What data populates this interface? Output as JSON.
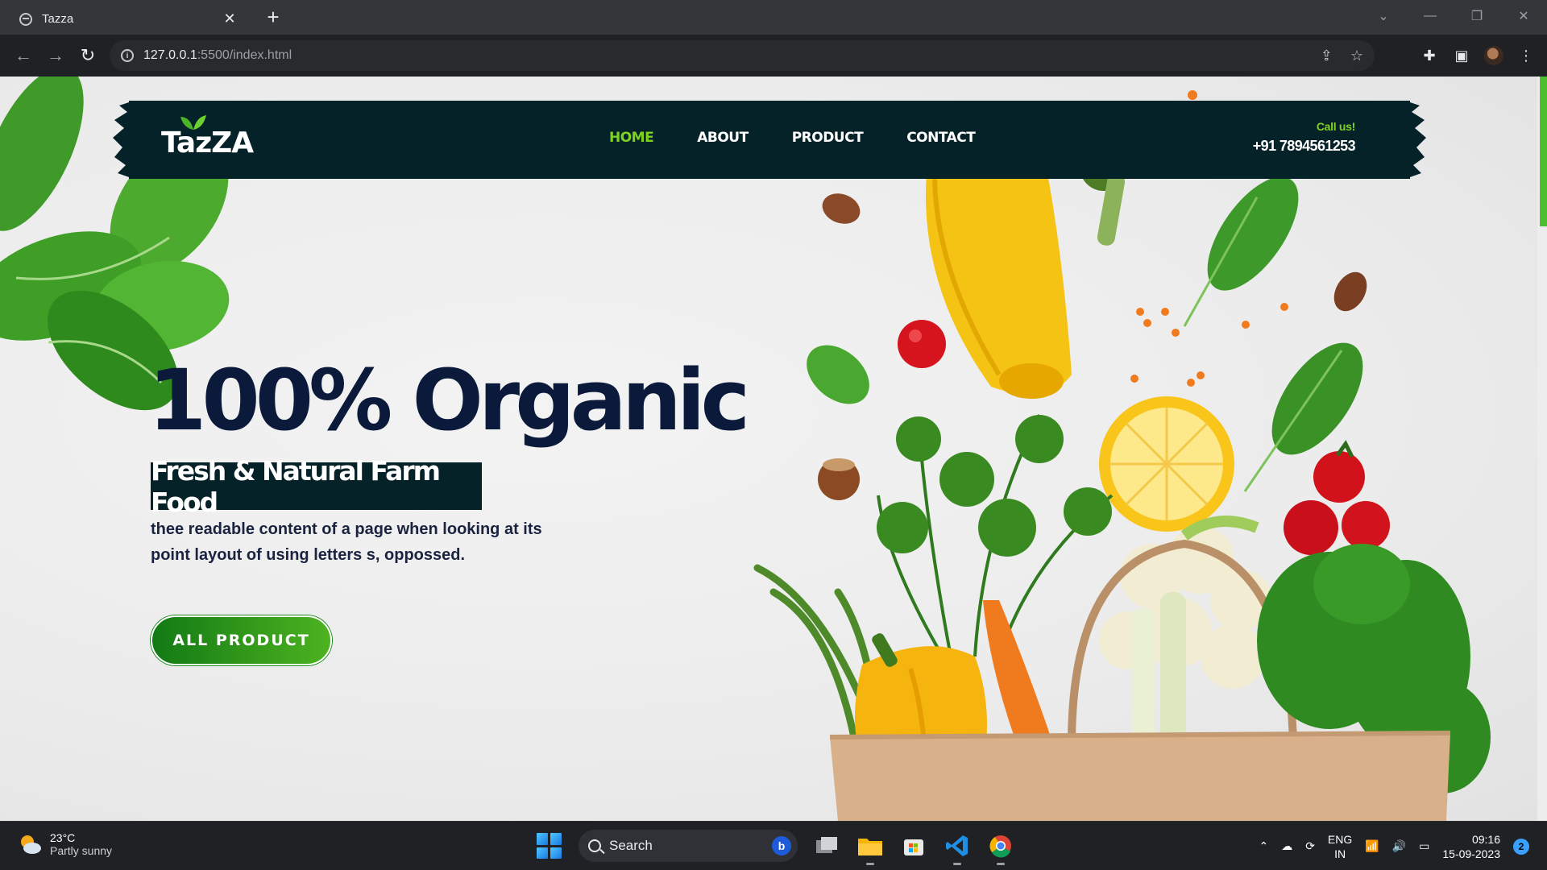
{
  "browser": {
    "tab_title": "Tazza",
    "tab_close": "✕",
    "new_tab": "+",
    "url_host": "127.0.0.1",
    "url_path": ":5500/index.html"
  },
  "site": {
    "logo": "TazZA",
    "nav": [
      {
        "label": "HOME",
        "active": true
      },
      {
        "label": "ABOUT",
        "active": false
      },
      {
        "label": "PRODUCT",
        "active": false
      },
      {
        "label": "CONTACT",
        "active": false
      }
    ],
    "call_label": "Call us!",
    "phone": "+91 7894561253",
    "hero_title": "100% Organic",
    "hero_subtitle": "Fresh & Natural Farm Food",
    "hero_desc_line1": "thee readable content of a page when looking at its",
    "hero_desc_line2": "point layout of using letters s, oppossed.",
    "cta_label": "ALL PRODUCT",
    "colors": {
      "accent": "#7ed321",
      "header_bg": "#062229",
      "title": "#0b1a3a",
      "cta_start": "#127a15",
      "cta_end": "#4db320"
    }
  },
  "taskbar": {
    "weather_temp": "23°C",
    "weather_desc": "Partly sunny",
    "search_label": "Search",
    "lang_line1": "ENG",
    "lang_line2": "IN",
    "time": "09:16",
    "date": "15-09-2023",
    "notification_count": "2",
    "apps": [
      "task-view-icon",
      "file-explorer-icon",
      "microsoft-store-icon",
      "vscode-icon",
      "chrome-icon"
    ]
  }
}
